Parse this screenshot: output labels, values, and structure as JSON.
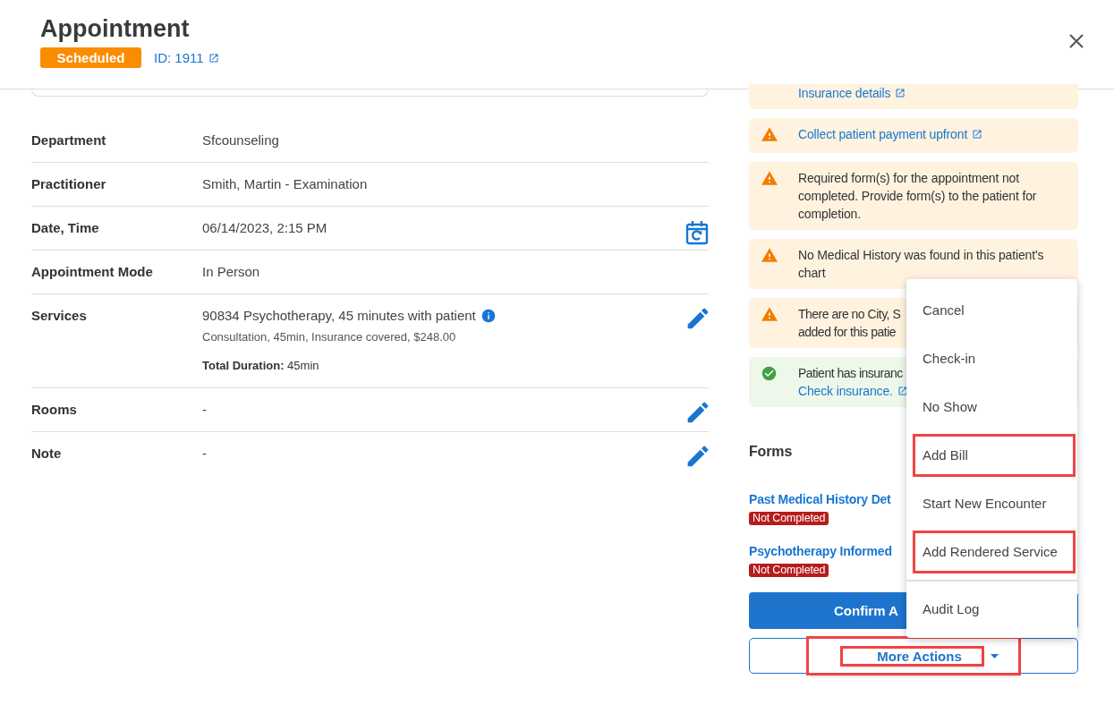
{
  "header": {
    "title": "Appointment",
    "status": {
      "label": "Scheduled",
      "kind": "scheduled"
    },
    "id_link": "ID: 1911"
  },
  "details": [
    {
      "label": "Department",
      "value": "Sfcounseling"
    },
    {
      "label": "Practitioner",
      "value": "Smith, Martin - Examination"
    },
    {
      "label": "Date, Time",
      "value": "06/14/2023, 2:15 PM",
      "reschedule": true
    },
    {
      "label": "Appointment Mode",
      "value": "In Person"
    },
    {
      "label": "Services",
      "value": "90834 Psychotherapy, 45 minutes with patient",
      "info": true,
      "sub": "Consultation, 45min, Insurance covered, $248.00",
      "total": "**Total Duration:** 45min",
      "edit": true
    },
    {
      "label": "Rooms",
      "value": "-",
      "edit": true
    },
    {
      "label": "Note",
      "value": "-",
      "edit": true
    }
  ],
  "alerts": [
    {
      "kind": "plain",
      "link": "Insurance details"
    },
    {
      "kind": "warning",
      "link": "Collect patient payment upfront"
    },
    {
      "kind": "warning",
      "text": "Required form(s) for the appointment not completed. Provide form(s) to the patient for completion."
    },
    {
      "kind": "warning",
      "text": "No Medical History was found in this patient's chart"
    },
    {
      "kind": "warning",
      "lines": [
        "There are no City, S",
        "added for this patie"
      ]
    },
    {
      "kind": "success",
      "text": "Patient has insuranc",
      "link": "Check insurance."
    }
  ],
  "forms": {
    "title": "Forms",
    "items": [
      {
        "name": "Past Medical History Det",
        "status": "Not Completed"
      },
      {
        "name": "Psychotherapy Informed",
        "status": "Not Completed"
      }
    ]
  },
  "confirm_button": "Confirm A",
  "more_actions": {
    "label": "More Actions",
    "highlighted": true
  },
  "menu": [
    {
      "label": "Cancel",
      "highlighted": false,
      "divider_before": false
    },
    {
      "label": "Check-in",
      "highlighted": false,
      "divider_before": false
    },
    {
      "label": "No Show",
      "highlighted": false,
      "divider_before": false
    },
    {
      "label": "Add Bill",
      "highlighted": true,
      "divider_before": false
    },
    {
      "label": "Start New Encounter",
      "highlighted": false,
      "divider_before": false
    },
    {
      "label": "Add Rendered Service",
      "highlighted": true,
      "divider_before": false
    },
    {
      "label": "Audit Log",
      "highlighted": false,
      "divider_before": true
    }
  ]
}
